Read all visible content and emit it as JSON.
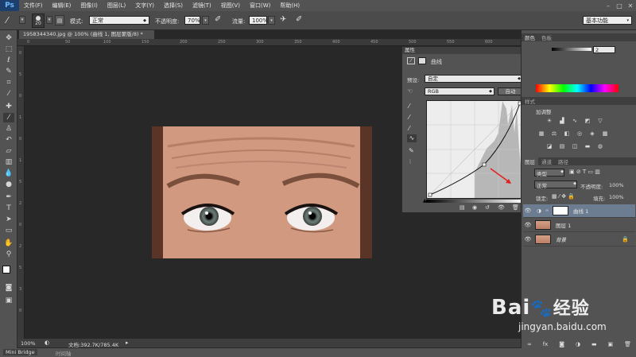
{
  "app": {
    "logo": "Ps",
    "menu": [
      "文件(F)",
      "编辑(E)",
      "图像(I)",
      "图层(L)",
      "文字(Y)",
      "选择(S)",
      "滤镜(T)",
      "视图(V)",
      "窗口(W)",
      "帮助(H)"
    ]
  },
  "options": {
    "brush_size": "20",
    "mode_label": "模式:",
    "mode_value": "正常",
    "opacity_label": "不透明度:",
    "opacity_value": "70%",
    "flow_label": "流量:",
    "flow_value": "100%",
    "workspace": "基本功能"
  },
  "document": {
    "tab_title": "1958344340.jpg @ 100% (曲线 1, 图层蒙版/8) *",
    "zoom": "100%",
    "doc_info": "文档:392.7K/785.4K",
    "ruler_h": [
      "0",
      "50",
      "100",
      "150",
      "200",
      "250",
      "300",
      "350",
      "400",
      "450",
      "500",
      "550",
      "600",
      "650"
    ],
    "ruler_v": [
      "0",
      "5",
      "0",
      "1",
      "0",
      "1",
      "5",
      "2",
      "0",
      "2",
      "5",
      "3",
      "0"
    ]
  },
  "properties": {
    "panel_title": "属性",
    "adjustment_name": "曲线",
    "preset_label": "预设:",
    "preset_value": "自定",
    "channel_value": "RGB",
    "auto_button": "自动"
  },
  "right_panels": {
    "color_tab": "颜色",
    "swatches_tab": "色板",
    "color_value": "2",
    "styles_tab": "样式",
    "adjustments_label": "加调整",
    "layers_tabs": [
      "图层",
      "通道",
      "路径"
    ],
    "kind_label": "类型",
    "blend_mode": "正常",
    "opacity_label": "不透明度:",
    "opacity_value": "100%",
    "fill_label": "填充:",
    "fill_value": "100%",
    "lock_label": "锁定:",
    "layers": [
      {
        "name": "曲线 1"
      },
      {
        "name": "图层 1"
      },
      {
        "name": "背景"
      }
    ]
  },
  "bottom": {
    "mini_bridge": "Mini Bridge",
    "timeline": "时间轴"
  },
  "watermark": {
    "brand": "Bai",
    "brand_cn": "经验",
    "url": "jingyan.baidu.com"
  }
}
